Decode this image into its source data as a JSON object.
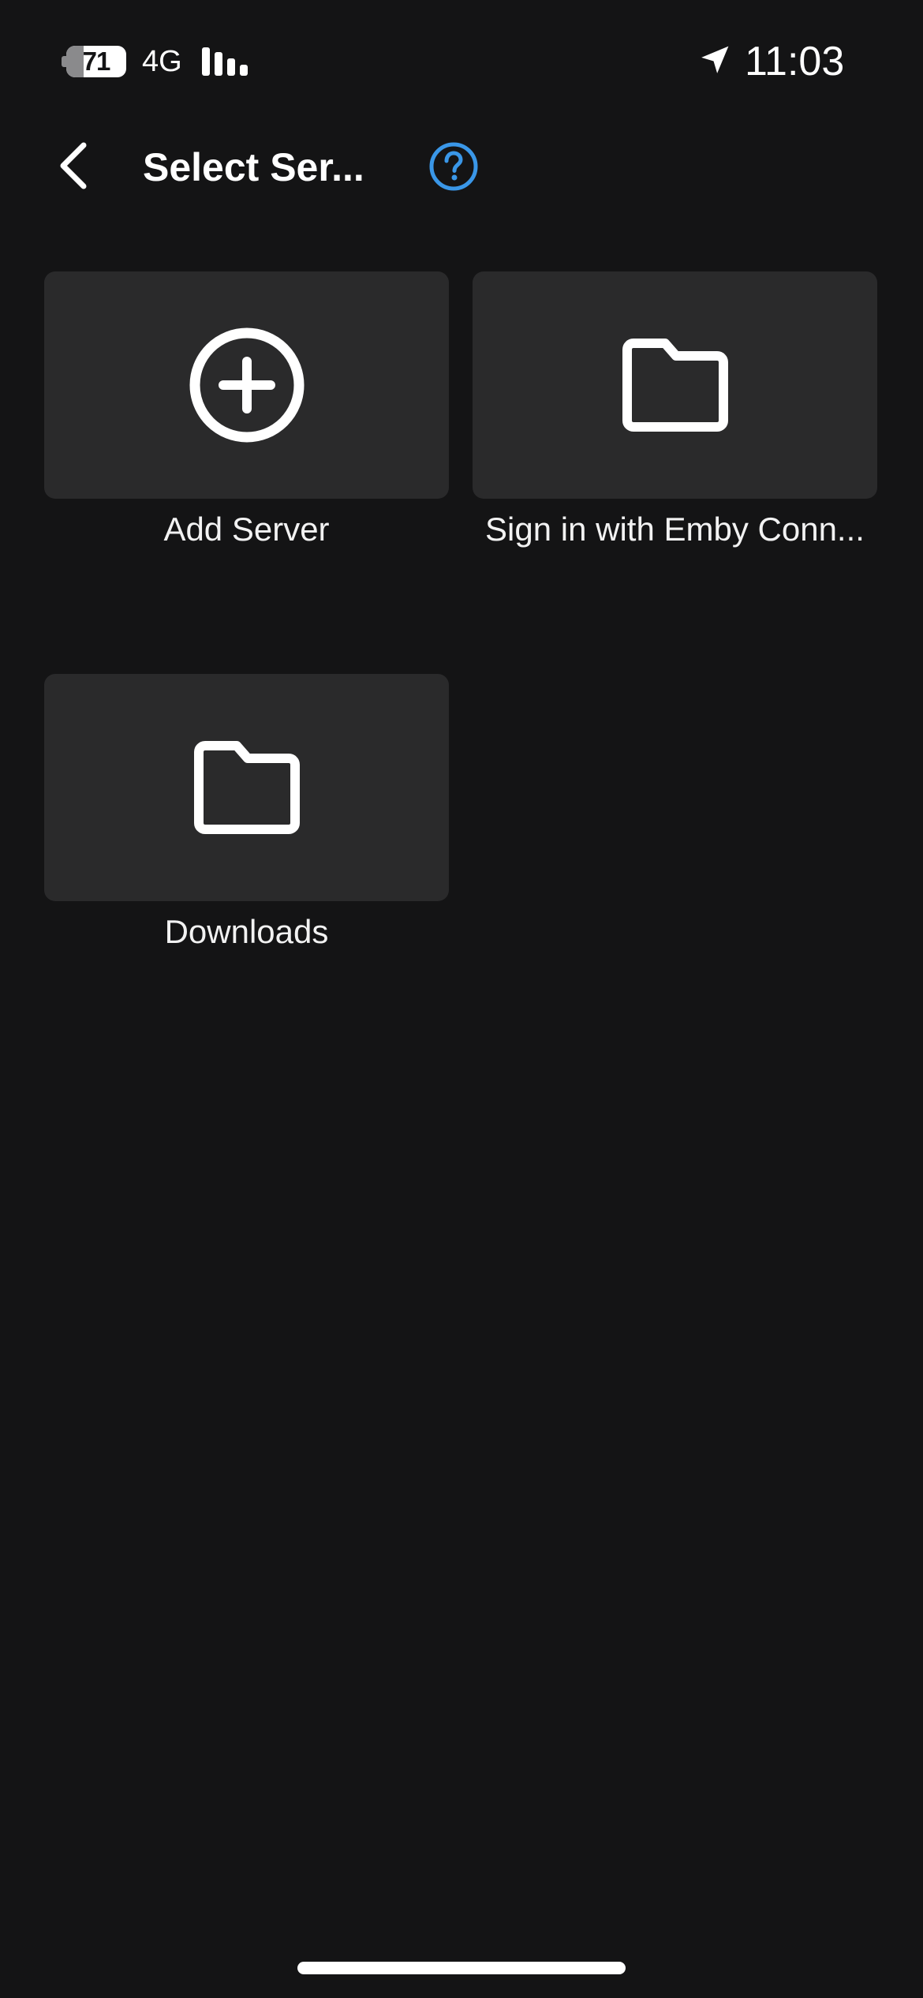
{
  "status_bar": {
    "battery_level": "71",
    "network": "4G",
    "time": "11:03",
    "icons": [
      "battery-icon",
      "cellular-signal-icon",
      "location-arrow-icon"
    ]
  },
  "header": {
    "title": "Select Ser...",
    "back_icon": "chevron-left-icon",
    "help_icon": "question-circle-icon"
  },
  "colors": {
    "background": "#141415",
    "tile": "#2a2a2b",
    "accent": "#3a97e8",
    "text": "#ffffff"
  },
  "tiles": [
    {
      "label": "Add Server",
      "icon": "plus-circle-icon"
    },
    {
      "label": "Sign in with Emby Conn...",
      "icon": "folder-icon"
    },
    {
      "label": "Downloads",
      "icon": "folder-icon"
    }
  ]
}
